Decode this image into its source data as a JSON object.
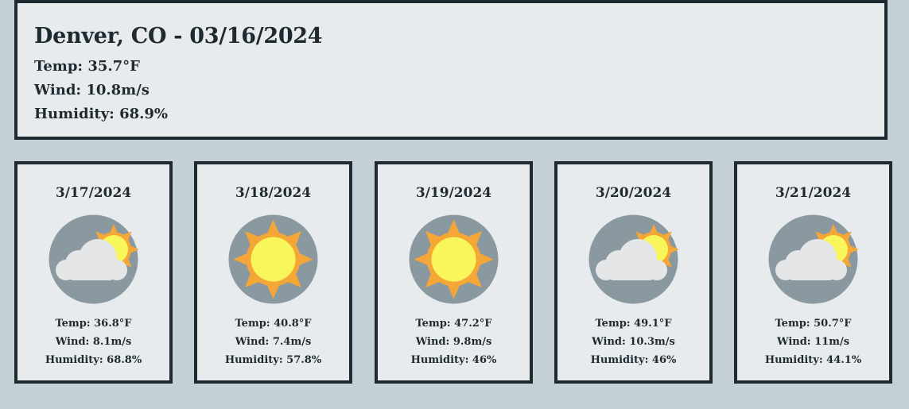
{
  "current": {
    "title": "Denver, CO - 03/16/2024",
    "temp": "Temp: 35.7°F",
    "wind": "Wind: 10.8m/s",
    "humidity": "Humidity: 68.9%"
  },
  "forecast": [
    {
      "date": "3/17/2024",
      "icon": "partly-cloudy-icon",
      "temp": "Temp: 36.8°F",
      "wind": "Wind: 8.1m/s",
      "humidity": "Humidity: 68.8%"
    },
    {
      "date": "3/18/2024",
      "icon": "sun-icon",
      "temp": "Temp: 40.8°F",
      "wind": "Wind: 7.4m/s",
      "humidity": "Humidity: 57.8%"
    },
    {
      "date": "3/19/2024",
      "icon": "sun-icon",
      "temp": "Temp: 47.2°F",
      "wind": "Wind: 9.8m/s",
      "humidity": "Humidity: 46%"
    },
    {
      "date": "3/20/2024",
      "icon": "partly-cloudy-icon",
      "temp": "Temp: 49.1°F",
      "wind": "Wind: 10.3m/s",
      "humidity": "Humidity: 46%"
    },
    {
      "date": "3/21/2024",
      "icon": "partly-cloudy-icon",
      "temp": "Temp: 50.7°F",
      "wind": "Wind: 11m/s",
      "humidity": "Humidity: 44.1%"
    }
  ],
  "colors": {
    "page_bg": "#c5d0d6",
    "card_bg": "#e7ebee",
    "border": "#1f2a30",
    "icon_bg": "#8a98a0",
    "sun_core": "#f8f65a",
    "sun_rays": "#f4a637",
    "cloud": "#e4e6e8"
  }
}
